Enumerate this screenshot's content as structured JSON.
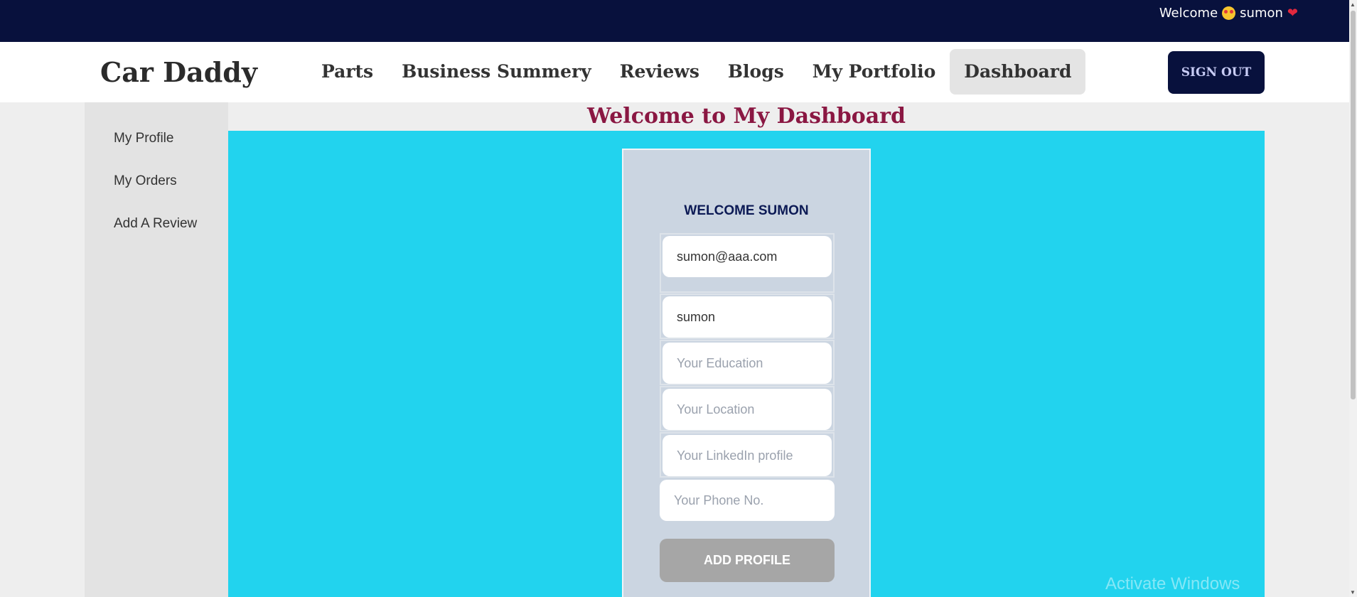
{
  "topbar": {
    "welcome_text": "Welcome",
    "user_name": "sumon"
  },
  "navbar": {
    "logo": "Car Daddy",
    "items": [
      {
        "label": "Parts"
      },
      {
        "label": "Business Summery"
      },
      {
        "label": "Reviews"
      },
      {
        "label": "Blogs"
      },
      {
        "label": "My Portfolio"
      },
      {
        "label": "Dashboard",
        "active": true
      }
    ],
    "signout_label": "SIGN OUT"
  },
  "sidebar": {
    "items": [
      {
        "label": "My Profile"
      },
      {
        "label": "My Orders"
      },
      {
        "label": "Add A Review"
      }
    ]
  },
  "page_title": "Welcome to My Dashboard",
  "profile_form": {
    "title": "WELCOME SUMON",
    "email_value": "sumon@aaa.com",
    "name_value": "sumon",
    "education_placeholder": "Your Education",
    "location_placeholder": "Your Location",
    "linkedin_placeholder": "Your LinkedIn profile",
    "phone_placeholder": "Your Phone No.",
    "submit_label": "ADD PROFILE"
  },
  "watermark": "Activate Windows",
  "colors": {
    "topbar_bg": "#08113d",
    "main_bg": "#22d3ee",
    "card_bg": "#cbd5e1",
    "title_color": "#8a1742",
    "button_disabled": "#a6a6a6"
  }
}
